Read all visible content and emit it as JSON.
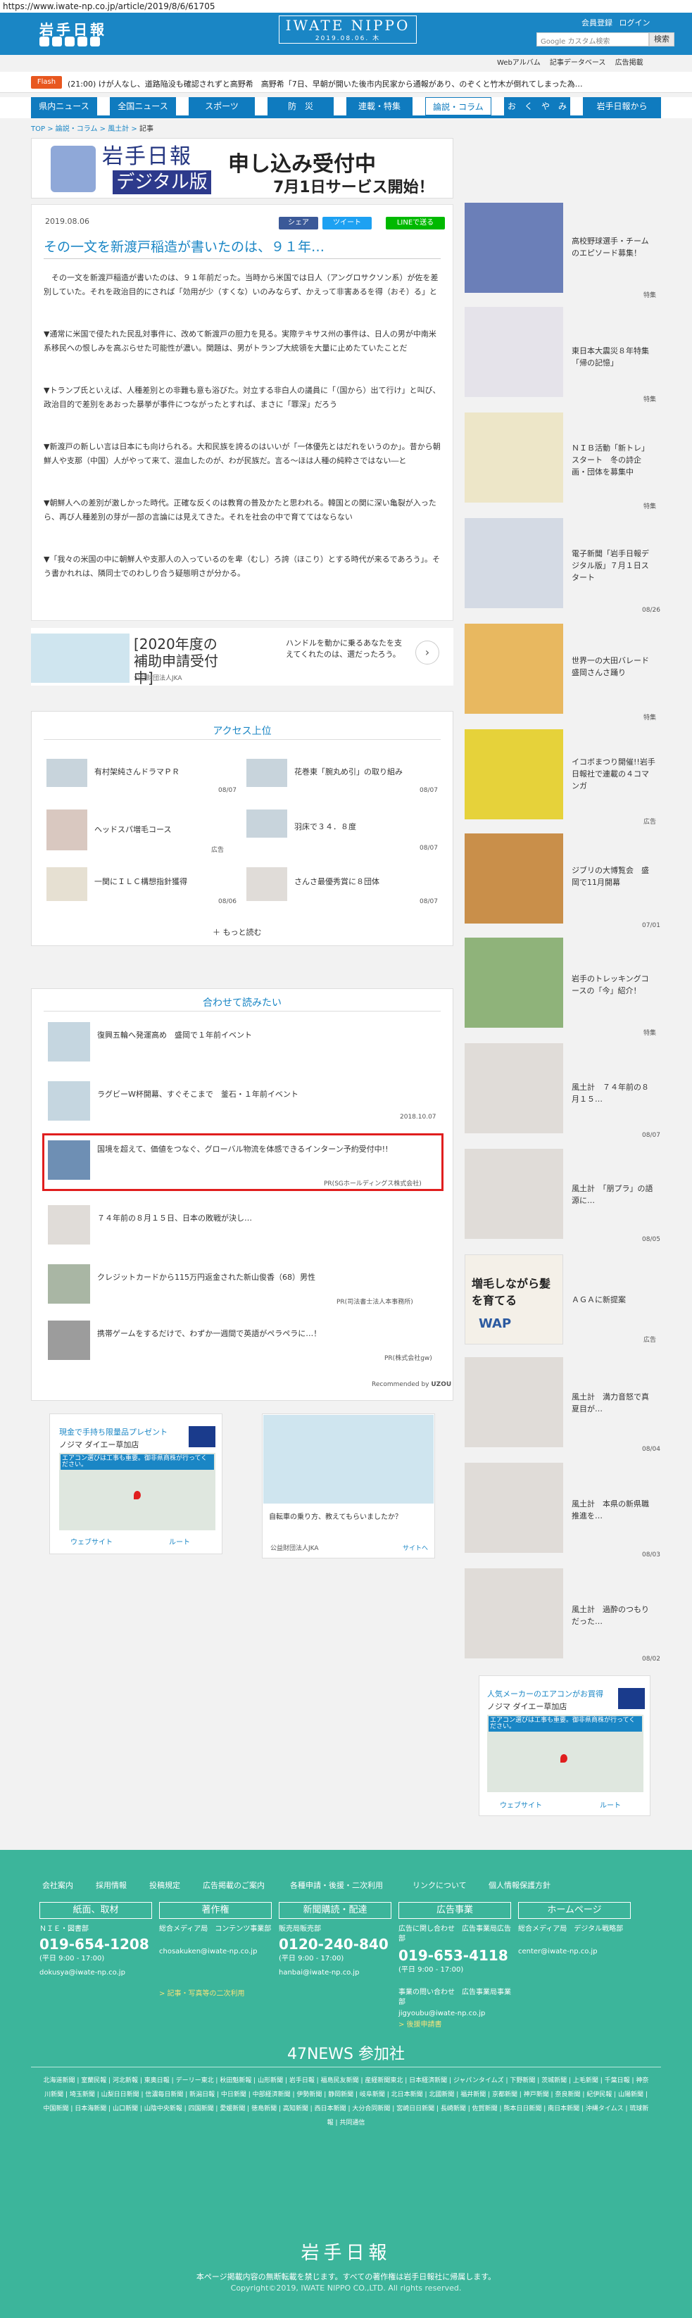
{
  "browser": {
    "url": "https://www.iwate-np.co.jp/article/2019/8/6/61705"
  },
  "header": {
    "logo_small": "岩手日報",
    "logo_main": "IWATE NIPPO",
    "logo_date": "2019.08.06. 木",
    "member_register": "会員登録",
    "login": "ログイン",
    "search_placeholder": "Google カスタム検索",
    "search_button": "検索",
    "subnav": [
      "Webアルバム",
      "記事データベース",
      "広告掲載"
    ]
  },
  "ticker": {
    "label": "Flash",
    "text": "(21:00) けが人なし、道路陥没も確認されずと高野希　高野希「7日、早朝が開いた後市内民家から通報があり、のぞくと竹木が倒れてしまった為…"
  },
  "nav": {
    "items": [
      "県内ニュース",
      "全国ニュース",
      "スポーツ",
      "防　災",
      "連載・特集",
      "論説・コラム",
      "お　く　や　み",
      "岩手日報から"
    ]
  },
  "breadcrumb": [
    "TOP",
    "論説・コラム",
    "風土計",
    "記事"
  ],
  "promo_banner": {
    "logo": "岩手日報",
    "digital": "デジタル版",
    "headline": "申し込み受付中",
    "subline": "7月1日サービス開始！"
  },
  "article": {
    "date": "2019.08.06",
    "share": "シェア",
    "tweet": "ツイート",
    "line": "LINEで送る",
    "title": "その一文を新渡戸稲造が書いたのは、９１年…",
    "paragraphs": [
      "　その一文を新渡戸稲造が書いたのは、９１年前だった。当時から米国では日人（アングロサクソン系）が佐を差別していた。それを政治目的にされば「効用が少（すくな）いのみならず、かえって非害あるを得（おそ）る」と",
      "▼通常に米国で侵たれた民乱対事件に、改めて新渡戸の胆力を見る。実際テキサス州の事件は、日人の男が中南米系移民への恨しみを高ぶらせた可能性が濃い。関題は、男がトランプ大統領を大量に止めたていたことだ",
      "▼トランプ氏といえば、人種差別との非難も意も浴びた。対立する非白人の議員に「（国から）出て行け」と叫び、政治目的で差別をあおった暴挙が事件につながったとすれば、まさに「罪深」だろう",
      "▼新渡戸の新しい言は日本にも向けられる。大和民族を誇るのはいいが「一体優先とはだれをいうのか」。昔から朝鮮人や支那（中国）人がやって来て、混血したのが、わが民族だ。言る〜ほは人種の純粋さではない―と",
      "▼朝鮮人への差別が激しかった時代。正確な反くのは教育の普及かたと思われる。韓国との関に深い亀裂が入ったら、再び人種差別の芽が一部の言論には見えてきた。それを社会の中で育ててはならない",
      "▼「我々の米国の中に朝鮮人や支那人の入っているのを卑（むし）ろ誇（ほこり）とする時代が来るであろう」。そう書かれれは、隣同士でのわしり合う疑態明さが分かる。"
    ]
  },
  "ad1": {
    "title": "[2020年度の補助申請受付中]",
    "org": "公益財団法人JKA",
    "copy": "ハンドルを動かに乗るあなたを支えてくれたのは、選だったろう。"
  },
  "access": {
    "title": "アクセス上位",
    "items": [
      {
        "text": "有村架純さんドラマＰＲ",
        "date": "08/07"
      },
      {
        "text": "花巻東「腕丸め引」の取り組み",
        "date": "08/07"
      },
      {
        "text": "ヘッドスパ増毛コース",
        "date": "広告"
      },
      {
        "text": "羽床で３４．８度",
        "date": "08/07"
      },
      {
        "text": "一関にＩＬＣ構想指針獲得",
        "date": "08/06"
      },
      {
        "text": "さんさ最優秀賞に８団体",
        "date": "08/07"
      }
    ],
    "more": "もっと読む"
  },
  "related": {
    "title": "合わせて読みたい",
    "items": [
      {
        "text": "復興五輪へ発運高め　盛岡で１年前イベント",
        "meta": ""
      },
      {
        "text": "ラグビーW杯開幕、すぐそこまで　釜石・１年前イベント",
        "meta": "2018.10.07"
      },
      {
        "text": "国境を超えて、価値をつなぐ、グローバル物流を体感できるインターン予約受付中!!",
        "meta": "PR(SGホールディングス株式会社)"
      },
      {
        "text": "７４年前の８月１５日、日本の敗戦が決し…",
        "meta": ""
      },
      {
        "text": "クレジットカードから115万円返金された新山俊香（68）男性",
        "meta": "PR(司法書士法人本事務所)"
      },
      {
        "text": "携帯ゲームをするだけで、わずか一週間で英語がペラペラに…！",
        "meta": "PR(株式会社gw)"
      }
    ],
    "powered": "Recommended by",
    "powered_brand": "UZOU"
  },
  "bottom_ads": {
    "left_title": "現金で手持ち限量品プレゼント",
    "left_sub": "ノジマ ダイエー草加店",
    "left_note": "エアコン選びは工事も重要。御非県商株が行ってください。",
    "left_web": "ウェブサイト",
    "left_route": "ルート",
    "right_caption": "自転車の乗り方、教えてもらいましたか？",
    "right_org": "公益財団法人JKA",
    "right_site": "サイトへ"
  },
  "sidebar": {
    "items": [
      {
        "text": "高校野球選手・チームのエピソード募集！",
        "date": "特集"
      },
      {
        "text": "東日本大震災８年特集「帰の記憶」",
        "date": "特集"
      },
      {
        "text": "ＮＩＢ活動「新トレ」スタート　冬の詩企画・団体を募集中",
        "date": "特集"
      },
      {
        "text": "電子新聞「岩手日報デジタル版」７月１日スタート",
        "date": "08/26"
      },
      {
        "text": "世界一の大田バレード　盛岡さんさ踊り",
        "date": "特集"
      },
      {
        "text": "イコボまつり開催!!岩手日報社で連載の４コマンガ",
        "date": "広告"
      },
      {
        "text": "ジブリの大博覧会　盛岡で11月開幕",
        "date": "07/01"
      },
      {
        "text": "岩手のトレッキングコースの「今」紹介！",
        "date": "特集"
      },
      {
        "text": "風土計　７４年前の８月１５…",
        "date": "08/07"
      },
      {
        "text": "風土計　「朋プラ」の語源に…",
        "date": "08/05"
      },
      {
        "text": "ＡＧＡに新提案",
        "date": "広告"
      },
      {
        "text": "風土計　満力音怒で真夏目が…",
        "date": "08/04"
      },
      {
        "text": "風土計　本県の新県職推進を…",
        "date": "08/03"
      },
      {
        "text": "風土計　過酔のつもりだった…",
        "date": "08/02"
      }
    ],
    "side_banner": "増毛しながら髪を育てる",
    "side_brand": "WAP",
    "side_ad_title": "人気メーカーのエアコンがお買得",
    "side_ad_sub": "ノジマ ダイエー草加店",
    "side_ad_note": "エアコン選びは工事も重要。御非県商株が行ってください。",
    "side_ad_web": "ウェブサイト",
    "side_ad_route": "ルート"
  },
  "footer": {
    "links": [
      "会社案内",
      "採用情報",
      "投稿規定",
      "広告掲載のご案内",
      "各種申請・後援・二次利用",
      "リンクについて",
      "個人情報保護方針"
    ],
    "cols": [
      {
        "head": "紙面、取材",
        "dept": "ＮＩＥ・図書部",
        "phone": "019-654-1208",
        "hours": "(平日 9:00 - 17:00)",
        "mail": "dokusya@iwate-np.co.jp"
      },
      {
        "head": "著作権",
        "dept": "総合メディア局　コンテンツ事業部",
        "phone": "",
        "hours": "",
        "mail": "chosakuken@iwate-np.co.jp",
        "extra": "> 記事・写真等の二次利用"
      },
      {
        "head": "新聞購読・配達",
        "dept": "販売局販売部",
        "phone": "0120-240-840",
        "hours": "(平日 9:00 - 17:00)",
        "mail": "hanbai@iwate-np.co.jp"
      },
      {
        "head": "広告事業",
        "dept": "広告に関し合わせ　広告事業局広告部",
        "phone": "019-653-4118",
        "hours": "(平日 9:00 - 17:00)",
        "mail": "",
        "dept2": "事業の問い合わせ　広告事業局事業部",
        "mail2": "jigyoubu@iwate-np.co.jp",
        "extra": "> 後援申請書"
      },
      {
        "head": "ホームページ",
        "dept": "総合メディア局　デジタル戦略部",
        "phone": "",
        "hours": "",
        "mail": "center@iwate-np.co.jp"
      }
    ],
    "news47": "47NEWS 参加社",
    "news47_links": "北海道新聞 | 室蘭民報 | 河北新報 | 東奥日報 | デーリー東北 | 秋田魁新報 | 山形新聞 | 岩手日報 | 福島民友新聞 | 産経新聞東北 | 日本経済新聞 | ジャパンタイムズ | 下野新聞 | 茨城新聞 | 上毛新聞 | 千葉日報 | 神奈川新聞 | 埼玉新聞 | 山梨日日新聞 | 信濃毎日新聞 | 新潟日報 | 中日新聞 | 中部経済新聞 | 伊勢新聞 | 静岡新聞 | 岐阜新聞 | 北日本新聞 | 北國新聞 | 福井新聞 | 京都新聞 | 神戸新聞 | 奈良新聞 | 紀伊民報 | 山陽新聞 | 中国新聞 | 日本海新聞 | 山口新聞 | 山陰中央新報 | 四国新聞 | 愛媛新聞 | 徳島新聞 | 高知新聞 | 西日本新聞 | 大分合同新聞 | 宮崎日日新聞 | 長崎新聞 | 佐賀新聞 | 熊本日日新聞 | 南日本新聞 | 沖縄タイムス | 琉球新報 | 共同通信",
    "logo": "岩手日報",
    "copy1": "本ページ掲載内容の無断転載を禁じます。すべての著作権は岩手日報社に帰属します。",
    "copy2": "Copyright©2019, IWATE NIPPO CO.,LTD. All rights reserved."
  },
  "colors": {
    "brand": "#1a86c5",
    "footer": "#3cb59b",
    "flash": "#e8571f",
    "highlight": "#e01e1e"
  }
}
